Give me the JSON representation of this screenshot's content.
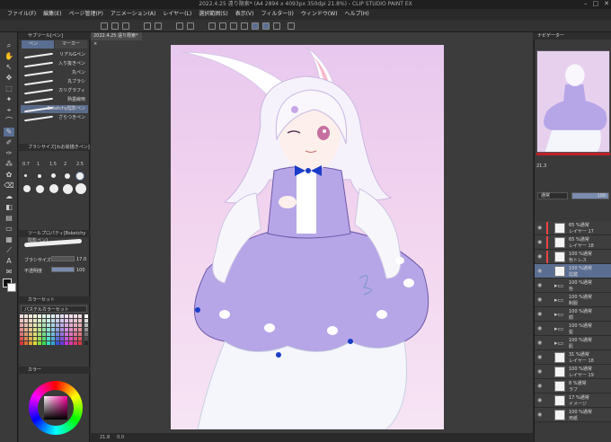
{
  "window": {
    "title": "2022.4.25 遠り限索* (A4 2894 x 4093px 350dpi 21.8%) - CLIP STUDIO PAINT EX"
  },
  "menu": [
    "ファイル(F)",
    "編集(E)",
    "ページ管理(P)",
    "アニメーション(A)",
    "レイヤー(L)",
    "選択範囲(S)",
    "表示(V)",
    "フィルター(I)",
    "ウィンドウ(W)",
    "ヘルプ(H)"
  ],
  "tools_left": [
    "虫",
    "✋",
    "⌕",
    "↖",
    "✦",
    "⌒",
    "✎",
    "✐",
    "▭",
    "⌫",
    "◧",
    "✣",
    "✂",
    "▤",
    "◐",
    "A",
    "✉",
    "⎌",
    "⚐",
    "∿",
    "⬚",
    "⬘"
  ],
  "subtool": {
    "tabs": [
      "ペン",
      "マーカー"
    ],
    "header": "サブツール[ペン]",
    "brushes": [
      "リアルGペン",
      "入り抜きペン",
      "丸ペン",
      "丸ブラシ",
      "カリグラフィ",
      "熟墨線用",
      "Bsketchy陰影ペン",
      "ざらつきペン"
    ],
    "selected_index": 6
  },
  "brush_size_panel": {
    "header": "ブラシサイズ[わお絵描きペン]",
    "sizes": [
      "0.7",
      "1",
      "1.5",
      "2",
      "2.5",
      "3",
      "4",
      "5",
      "6",
      "7",
      "8",
      "10",
      "12",
      "15",
      "17",
      "20",
      "25",
      "30",
      "40",
      "50"
    ]
  },
  "tool_property": {
    "header": "ツールプロパティ[Bsketchy陰影ペン]",
    "brush_size_label": "ブラシサイズ",
    "brush_size_value": "17.0",
    "opacity_label": "不透明度",
    "opacity_value": "100"
  },
  "color_set": {
    "header": "カラーセット",
    "name": "パステルカラーセット"
  },
  "color_wheel": {
    "header": "カラー"
  },
  "doc_tab": "2022.4.25 遠り限索* ×",
  "statusbar": {
    "zoom": "21.8",
    "rotate": "0.0"
  },
  "navigator": {
    "header": "ナビゲーター"
  },
  "layer_panel": {
    "blend": "通常",
    "opacity": "100",
    "zoom": "21.3",
    "layers": [
      {
        "l1": "65 %通常",
        "l2": "レイヤー 17",
        "kind": "layer",
        "clip": "#e44"
      },
      {
        "l1": "65 %通常",
        "l2": "レイヤー 18",
        "kind": "layer",
        "clip": "#e44"
      },
      {
        "l1": "100 %通常",
        "l2": "色トレス",
        "kind": "layer",
        "clip": "#e44"
      },
      {
        "l1": "100 %通常",
        "l2": "陰鍵",
        "kind": "layer",
        "selected": true
      },
      {
        "l1": "100 %通常",
        "l2": "色",
        "kind": "folder"
      },
      {
        "l1": "100 %通常",
        "l2": "制服",
        "kind": "folder"
      },
      {
        "l1": "100 %通常",
        "l2": "顔",
        "kind": "folder"
      },
      {
        "l1": "100 %通常",
        "l2": "髪",
        "kind": "folder"
      },
      {
        "l1": "100 %通常",
        "l2": "肌",
        "kind": "folder"
      },
      {
        "l1": "31 %通常",
        "l2": "レイヤー 18",
        "kind": "layer"
      },
      {
        "l1": "100 %通常",
        "l2": "レイヤー 19",
        "kind": "layer"
      },
      {
        "l1": "8 %通常",
        "l2": "ラフ",
        "kind": "layer"
      },
      {
        "l1": "17 %通常",
        "l2": "イメージ",
        "kind": "layer"
      },
      {
        "l1": "100 %通常",
        "l2": "用紙",
        "kind": "layer"
      }
    ]
  },
  "colors": {
    "accent": "#5a6e92",
    "nav_bar": "#c0202a",
    "dress": "#b6a6e8",
    "bow": "#1a3cc8"
  }
}
